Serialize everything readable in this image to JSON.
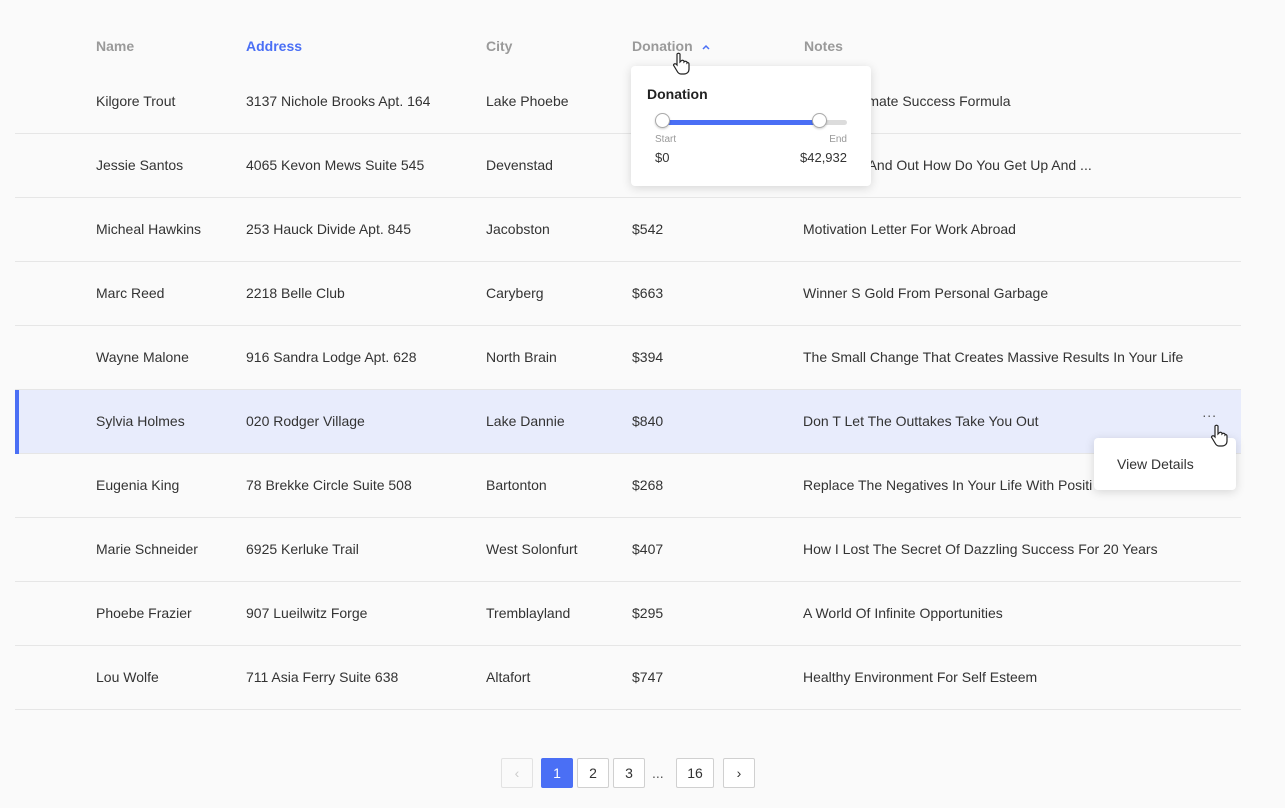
{
  "columns": {
    "name": "Name",
    "address": "Address",
    "city": "City",
    "donation": "Donation",
    "notes": "Notes"
  },
  "rows": [
    {
      "name": "Kilgore Trout",
      "address": "3137 Nichole Brooks Apt. 164",
      "city": "Lake Phoebe",
      "donation": "",
      "notes": "er The Ultimate Success Formula"
    },
    {
      "name": "Jessie Santos",
      "address": "4065 Kevon Mews Suite 545",
      "city": "Devenstad",
      "donation": "",
      "notes": "Are Down And Out How Do You Get Up And ..."
    },
    {
      "name": "Micheal Hawkins",
      "address": "253 Hauck Divide Apt. 845",
      "city": "Jacobston",
      "donation": "$542",
      "notes": "Motivation Letter For Work Abroad"
    },
    {
      "name": "Marc Reed",
      "address": "2218 Belle Club",
      "city": "Caryberg",
      "donation": "$663",
      "notes": "Winner S Gold From Personal Garbage"
    },
    {
      "name": "Wayne Malone",
      "address": "916 Sandra Lodge Apt. 628",
      "city": "North Brain",
      "donation": "$394",
      "notes": "The Small Change That Creates Massive Results In Your Life"
    },
    {
      "name": "Sylvia Holmes",
      "address": "020 Rodger Village",
      "city": "Lake Dannie",
      "donation": "$840",
      "notes": "Don T Let The Outtakes Take You Out"
    },
    {
      "name": "Eugenia King",
      "address": "78 Brekke Circle Suite 508",
      "city": "Bartonton",
      "donation": "$268",
      "notes": "Replace The Negatives In Your Life With Positi"
    },
    {
      "name": "Marie Schneider",
      "address": "6925 Kerluke Trail",
      "city": "West Solonfurt",
      "donation": "$407",
      "notes": "How I Lost The Secret Of Dazzling Success For 20 Years"
    },
    {
      "name": "Phoebe Frazier",
      "address": "907 Lueilwitz Forge",
      "city": "Tremblayland",
      "donation": "$295",
      "notes": "A World Of Infinite Opportunities"
    },
    {
      "name": "Lou Wolfe",
      "address": "711 Asia Ferry Suite 638",
      "city": "Altafort",
      "donation": "$747",
      "notes": "Healthy Environment For Self Esteem"
    }
  ],
  "row_actions": {
    "more": "...",
    "view_details": "View Details"
  },
  "donation_filter": {
    "title": "Donation",
    "start_label": "Start",
    "end_label": "End",
    "start_value": "$0",
    "end_value": "$42,932",
    "range_start_fraction": 0.0,
    "range_end_fraction": 0.85
  },
  "pagination": {
    "prev": "‹",
    "pages": [
      "1",
      "2",
      "3"
    ],
    "ellipsis": "...",
    "last": "16",
    "next": "›",
    "current": "1"
  },
  "colors": {
    "accent": "#4a6ff5",
    "selected_row": "#e8ecfc"
  },
  "icons": {
    "sort": "chevron-up-icon",
    "cursor": "hand-pointer-icon"
  }
}
